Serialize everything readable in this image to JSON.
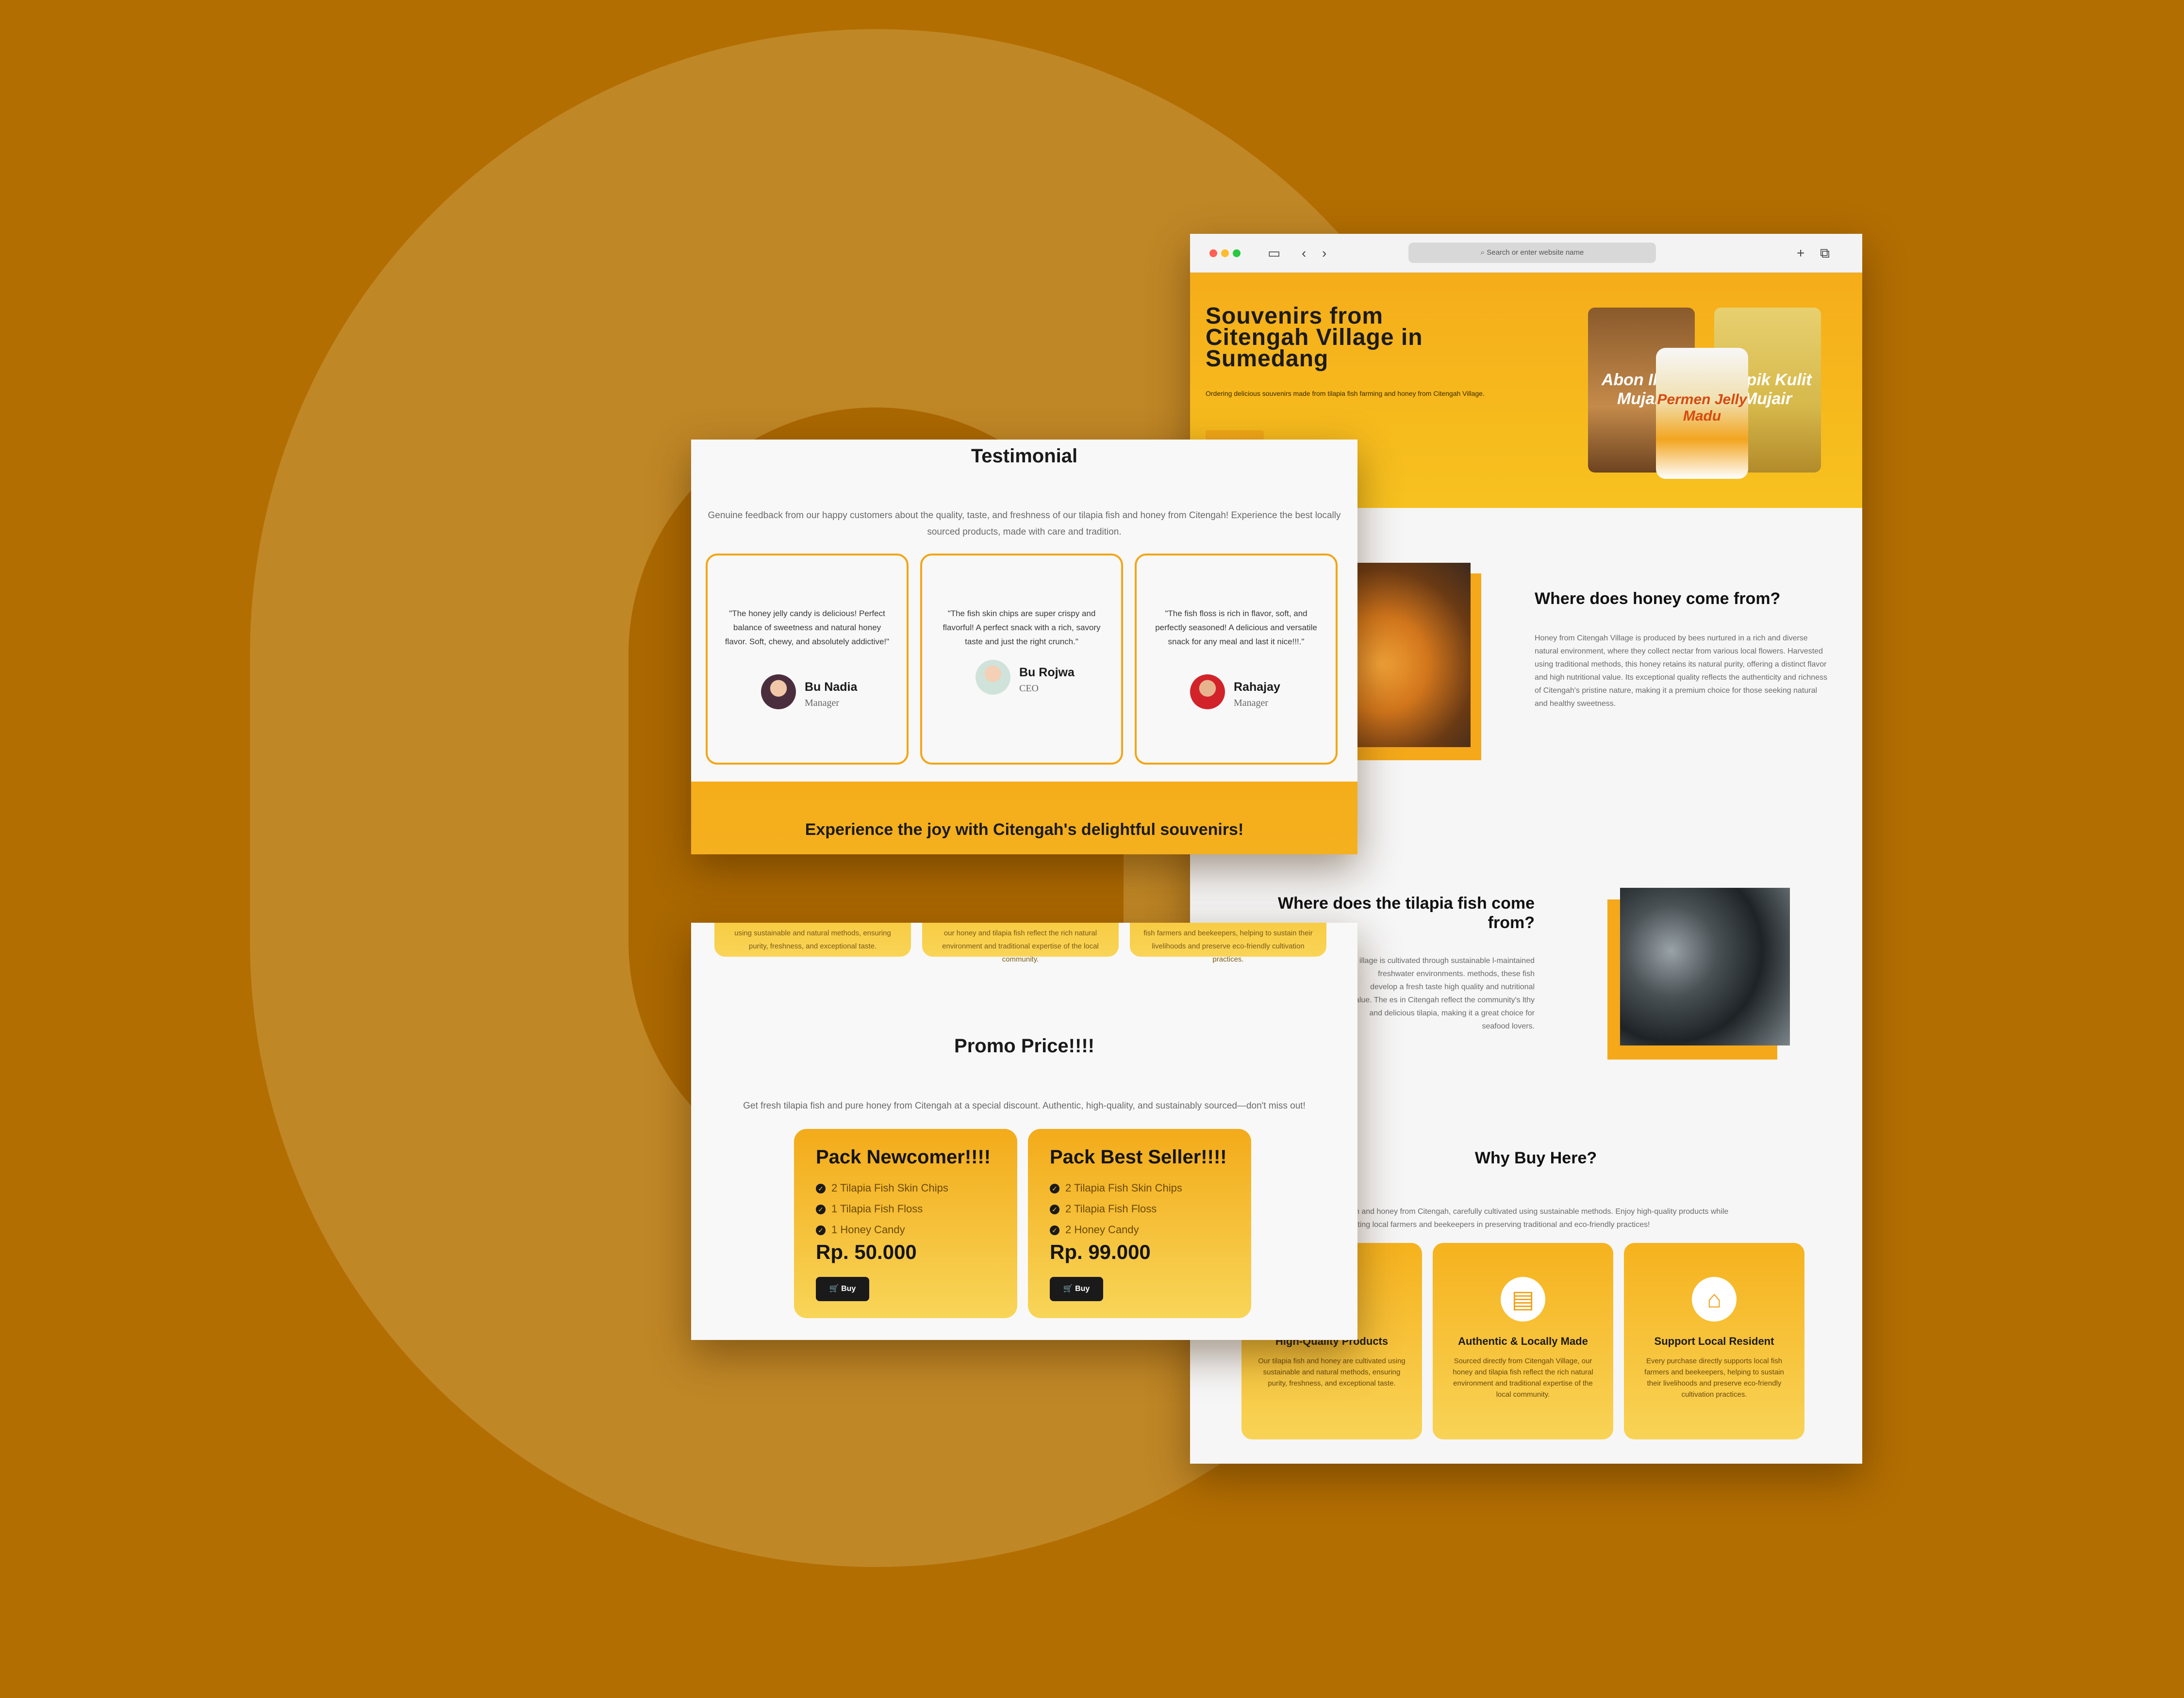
{
  "browser": {
    "address_placeholder": "Search or enter website name",
    "hero": {
      "title": "Souvenirs from Citengah Village in Sumedang",
      "description": "Ordering delicious souvenirs made from tilapia fish farming and honey from Citengah Village.",
      "products": [
        "Abon Ikan Mujair",
        "Permen Jelly Madu",
        "Kripik Kulit Mujair"
      ]
    },
    "honey": {
      "title": "Where does honey come from?",
      "text": "Honey from Citengah Village is produced by bees nurtured in a rich and diverse natural environment, where they collect nectar from various local flowers. Harvested using traditional methods, this honey retains its natural purity, offering a distinct flavor and high nutritional value. Its exceptional quality reflects the authenticity and richness of Citengah's pristine nature, making it a premium choice for those seeking natural and healthy sweetness."
    },
    "tilapia": {
      "title": "Where does the tilapia fish come from?",
      "text": "illage is cultivated through sustainable l-maintained freshwater environments. methods, these fish develop a fresh taste high quality and nutritional value. The es in Citengah reflect the community's lthy and delicious tilapia, making it a great choice for seafood lovers."
    },
    "why": {
      "title": "Why Buy Here?",
      "text_line1": "h and honey from Citengah, carefully cultivated using sustainable methods. Enjoy high-quality products while",
      "text_line2": "rting local farmers and beekeepers in preserving traditional and eco-friendly practices!",
      "cards": [
        {
          "title": "High-Quality Products",
          "text": "Our tilapia fish and honey are cultivated using sustainable and natural methods, ensuring purity, freshness, and exceptional taste."
        },
        {
          "title": "Authentic & Locally Made",
          "text": "Sourced directly from Citengah Village, our honey and tilapia fish reflect the rich natural environment and traditional expertise of the local community."
        },
        {
          "title": "Support Local Resident",
          "text": "Every purchase directly supports local fish farmers and beekeepers, helping to sustain their livelihoods and preserve eco-friendly cultivation practices."
        }
      ]
    }
  },
  "testimonial": {
    "title": "Testimonial",
    "description": "Genuine feedback from our happy customers about the quality, taste, and freshness of our tilapia fish and honey from Citengah! Experience the best locally sourced products, made with care and tradition.",
    "cards": [
      {
        "quote": "\"The honey jelly candy is delicious! Perfect balance of sweetness and natural honey flavor. Soft, chewy, and absolutely addictive!\"",
        "name": "Bu Nadia",
        "role": "Manager"
      },
      {
        "quote": "\"The fish skin chips are super crispy and flavorful! A perfect snack with a rich, savory taste and just the right crunch.\"",
        "name": "Bu Rojwa",
        "role": "CEO"
      },
      {
        "quote": "\"The fish floss is rich in flavor, soft, and perfectly seasoned! A delicious and versatile snack for any meal and last it nice!!!.\"",
        "name": "Rahajay",
        "role": "Manager"
      }
    ],
    "banner": "Experience the joy with Citengah's delightful souvenirs!"
  },
  "promo": {
    "partial_cards": [
      "using sustainable and natural methods, ensuring purity, freshness, and exceptional taste.",
      "our honey and tilapia fish reflect the rich natural environment and traditional expertise of the local community.",
      "fish farmers and beekeepers, helping to sustain their livelihoods and preserve eco-friendly cultivation practices."
    ],
    "title": "Promo Price!!!!",
    "description": "Get fresh tilapia fish and pure honey from Citengah at a special discount. Authentic, high-quality, and sustainably sourced—don't miss out!",
    "offers": [
      {
        "title": "Pack Newcomer!!!!",
        "items": [
          "2 Tilapia Fish Skin Chips",
          "1 Tilapia Fish Floss",
          "1 Honey Candy"
        ],
        "price": "Rp. 50.000",
        "button": "Buy"
      },
      {
        "title": "Pack Best Seller!!!!",
        "items": [
          "2 Tilapia Fish Skin Chips",
          "2 Tilapia Fish Floss",
          "2 Honey Candy"
        ],
        "price": "Rp. 99.000",
        "button": "Buy"
      }
    ]
  },
  "colors": {
    "background": "#b36e02",
    "accent": "#f5ad1a",
    "text": "#1a1a1a"
  }
}
